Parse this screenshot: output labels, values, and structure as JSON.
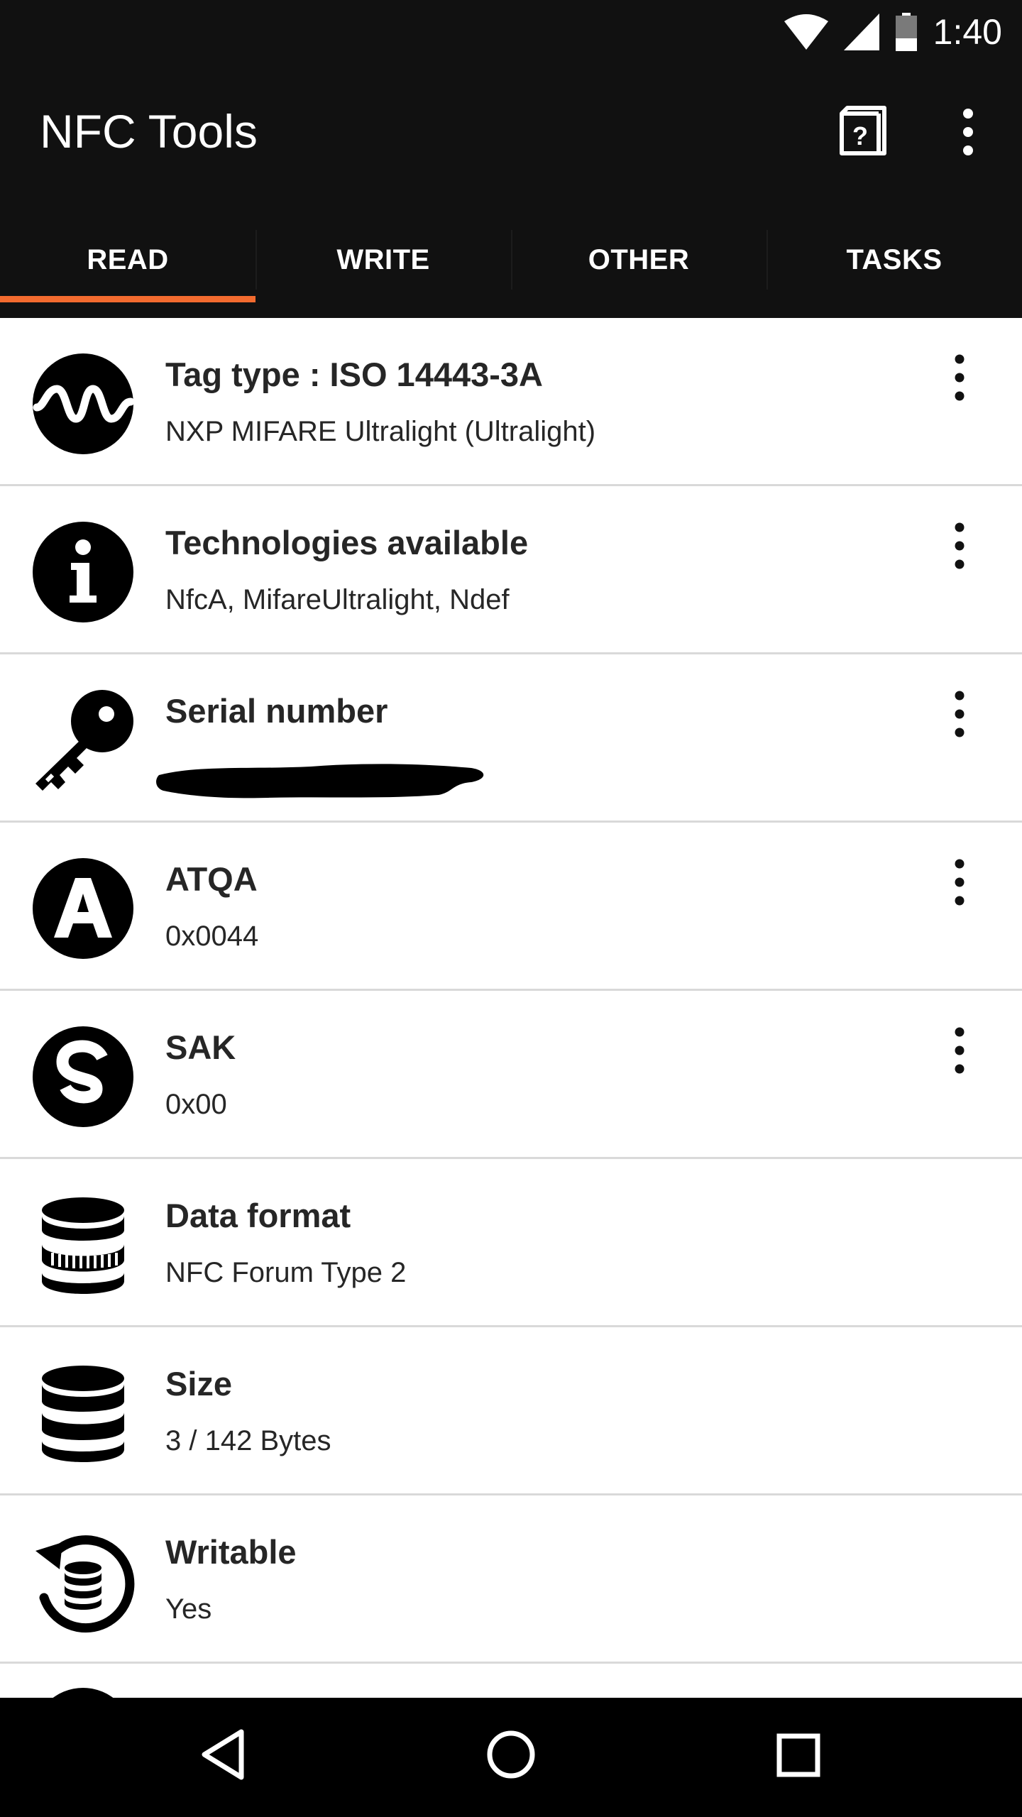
{
  "status_bar": {
    "time": "1:40",
    "icons": [
      "wifi-icon",
      "cell-signal-icon",
      "battery-icon"
    ]
  },
  "app_bar": {
    "title": "NFC Tools",
    "actions": [
      "help-icon",
      "overflow-menu-icon"
    ]
  },
  "tabs": [
    {
      "label": "READ",
      "selected": true
    },
    {
      "label": "WRITE",
      "selected": false
    },
    {
      "label": "OTHER",
      "selected": false
    },
    {
      "label": "TASKS",
      "selected": false
    }
  ],
  "rows": [
    {
      "icon": "waveform-icon",
      "title": "Tag type : ISO 14443-3A",
      "value": "NXP MIFARE Ultralight (Ultralight)",
      "has_menu": true
    },
    {
      "icon": "info-icon",
      "title": "Technologies available",
      "value": "NfcA, MifareUltralight, Ndef",
      "has_menu": true
    },
    {
      "icon": "key-icon",
      "title": "Serial number",
      "value": "",
      "redacted": true,
      "has_menu": true
    },
    {
      "icon": "letter-a-icon",
      "title": "ATQA",
      "value": "0x0044",
      "has_menu": true
    },
    {
      "icon": "letter-s-icon",
      "title": "SAK",
      "value": "0x00",
      "has_menu": true
    },
    {
      "icon": "database-format-icon",
      "title": "Data format",
      "value": "NFC Forum Type 2",
      "has_menu": false
    },
    {
      "icon": "database-icon",
      "title": "Size",
      "value": "3 / 142 Bytes",
      "has_menu": false
    },
    {
      "icon": "writable-icon",
      "title": "Writable",
      "value": "Yes",
      "has_menu": false
    }
  ],
  "nav_bar": {
    "buttons": [
      "back-icon",
      "home-icon",
      "recents-icon"
    ]
  },
  "colors": {
    "bar_background": "#111111",
    "tab_indicator": "#f36b2f",
    "divider": "#d9d9d9",
    "text": "#262626"
  }
}
